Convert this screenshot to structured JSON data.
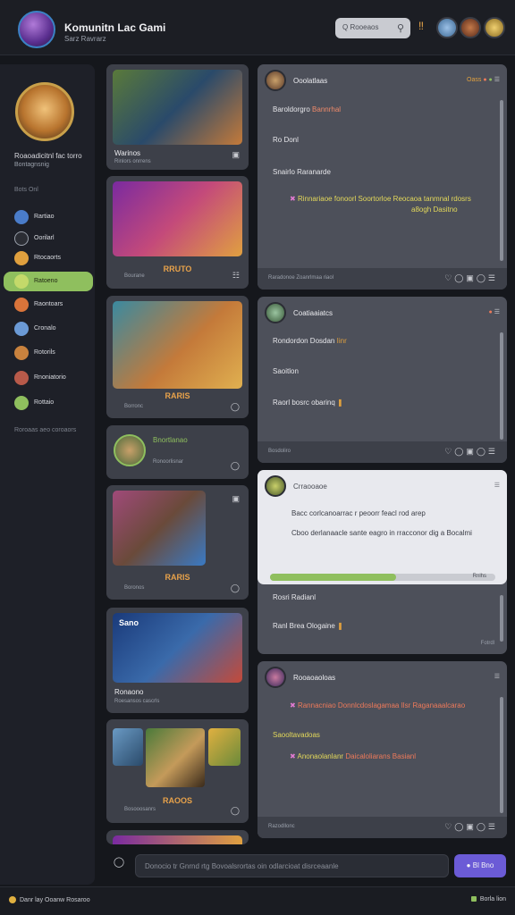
{
  "header": {
    "title": "Komunitn Lac Gami",
    "subtitle": "Sarz Ravrarz",
    "search_placeholder": "Q Rooeaos",
    "accent": "#6b5bd6"
  },
  "sidebar": {
    "profile_name": "Roaoadicitnl fac torro",
    "profile_sub": "Bontagnsnig",
    "section": "Bots Onl",
    "items": [
      {
        "label": "Rartiao",
        "color": "#4a7cc9"
      },
      {
        "label": "Oorilarl",
        "color": "#2b2d34"
      },
      {
        "label": "Rtocaorts",
        "color": "#e0a03e"
      },
      {
        "label": "Ratoeno",
        "color": "#c4d96a"
      },
      {
        "label": "Raontoars",
        "color": "#d9743a"
      },
      {
        "label": "Cronalo",
        "color": "#6b9ad6"
      },
      {
        "label": "Rotorils",
        "color": "#c9823e"
      },
      {
        "label": "Rnoniatorio",
        "color": "#b85a4a"
      },
      {
        "label": "Rottaio",
        "color": "#8fbf5e"
      }
    ],
    "footer": "Roroaas aeo coroaors"
  },
  "feed": [
    {
      "title": "Warinos",
      "meta": "Rinlors onrrens"
    },
    {
      "center": "RRUTO",
      "meta": "Bourane"
    },
    {
      "center": "RARIS",
      "meta": "Borronc"
    },
    {
      "tag": "Bnortlanao",
      "meta": "Ronoorlisnar"
    },
    {
      "center": "RARIS",
      "meta": "Boronos"
    },
    {
      "title": "Ronaono",
      "meta": "Roesansos cascrls",
      "badge": "Sano"
    },
    {
      "center": "RAOOS",
      "meta": "Bosooosanrs"
    }
  ],
  "threads": [
    {
      "title": "Ooolatlaas",
      "line1": "Baroldorgro",
      "line1_hl": "Bannrhal",
      "line2": "Ro Donl",
      "line3": "Snairlo Raranarde",
      "hl_a": "Rinnariaoe fonoorl Soortorloe Reocaoa tanmnal rdosrs",
      "hl_b": "a8ogh Dasitno",
      "foot": "Raradonoe Zoanrlmaa riaol"
    },
    {
      "title": "Coatiaaiatcs",
      "line1": "Rondordon Dosdan",
      "line1_hl": "Iinr",
      "line2": "Saoitlon",
      "line3": "Raorl bosrc obarinq",
      "foot": "Bosdoliro"
    },
    {
      "title": "Crraooaoe",
      "line1": "Bacc corlcanoarrac r peoorr feacl rod arep",
      "line2": "Cboo derlanaacle sante eagro in rracconor dig a Bocalmi",
      "progress": 0.56,
      "progress_label": "Rnlhs",
      "line3": "Rosri Radianl",
      "line4": "Ranl Brea Ologaine",
      "foot": "Fotrdl"
    },
    {
      "title": "Rooaoaoloas",
      "hl_a": "Rannacniao Donnlcdoslagamaa Ilsr Raganaaalcarao",
      "line2": "Saooltavadoas",
      "hl_b": "Anonaolanlanr",
      "hl_b2": "Daicaloliarans Basianl",
      "foot": "Razodllonc"
    }
  ],
  "composer": {
    "placeholder": "Donocio tr Gnrnd rtg Bovoalsrortas oin odlarcioat disrceaanle",
    "send": "Bl Bno"
  },
  "status": {
    "left": "Danr lay   Ooanw   Rosaroo",
    "right": "Borla lion"
  }
}
